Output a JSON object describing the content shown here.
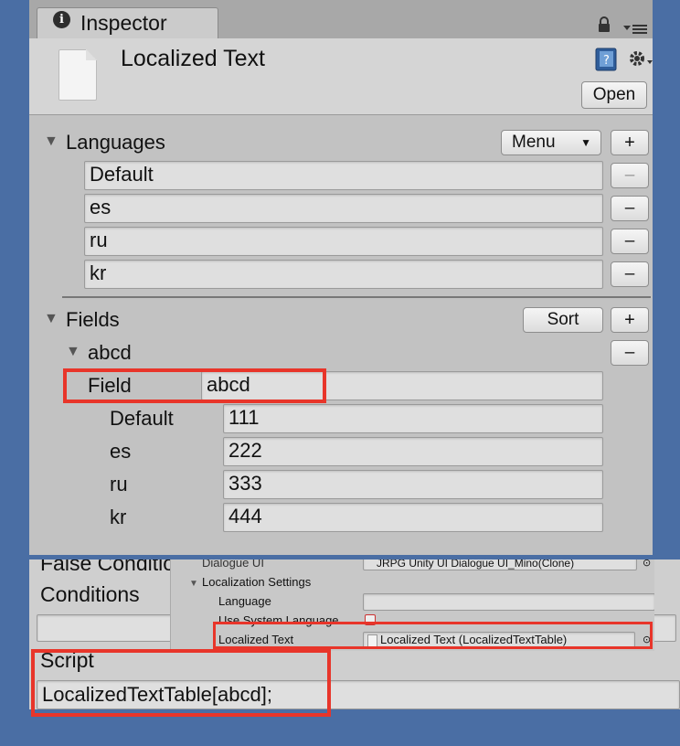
{
  "inspector": {
    "tab_label": "Inspector",
    "tab_icon": "i",
    "asset_title": "Localized Text",
    "open_button": "Open",
    "languages": {
      "header": "Languages",
      "menu_button": "Menu",
      "menu_arrow": "▼",
      "add_button": "+",
      "items": [
        {
          "value": "Default",
          "remove": "–"
        },
        {
          "value": "es",
          "remove": "–"
        },
        {
          "value": "ru",
          "remove": "–"
        },
        {
          "value": "kr",
          "remove": "–"
        }
      ]
    },
    "fields": {
      "header": "Fields",
      "sort_button": "Sort",
      "add_button": "+",
      "entry": {
        "name": "abcd",
        "remove": "–",
        "field_label": "Field",
        "field_value": "abcd",
        "translations": [
          {
            "lang": "Default",
            "value": "111"
          },
          {
            "lang": "es",
            "value": "222"
          },
          {
            "lang": "ru",
            "value": "333"
          },
          {
            "lang": "kr",
            "value": "444"
          }
        ]
      }
    }
  },
  "bottom_panel": {
    "false_condition_label": "False Conditio",
    "conditions_label": "Conditions",
    "script_label": "Script",
    "script_value": "LocalizedTextTable[abcd];",
    "popup": {
      "dialogue_label": "Dialogue UI",
      "dialogue_value": "JRPG Unity UI Dialogue UI_Mino(Clone)",
      "section_label": "Localization Settings",
      "language_label": "Language",
      "use_system_language_label": "Use System Language",
      "localized_text_label": "Localized Text",
      "localized_text_value": "Localized Text (LocalizedTextTable)"
    }
  },
  "colors": {
    "background": "#4a6ea4",
    "highlight": "#e8352a"
  }
}
